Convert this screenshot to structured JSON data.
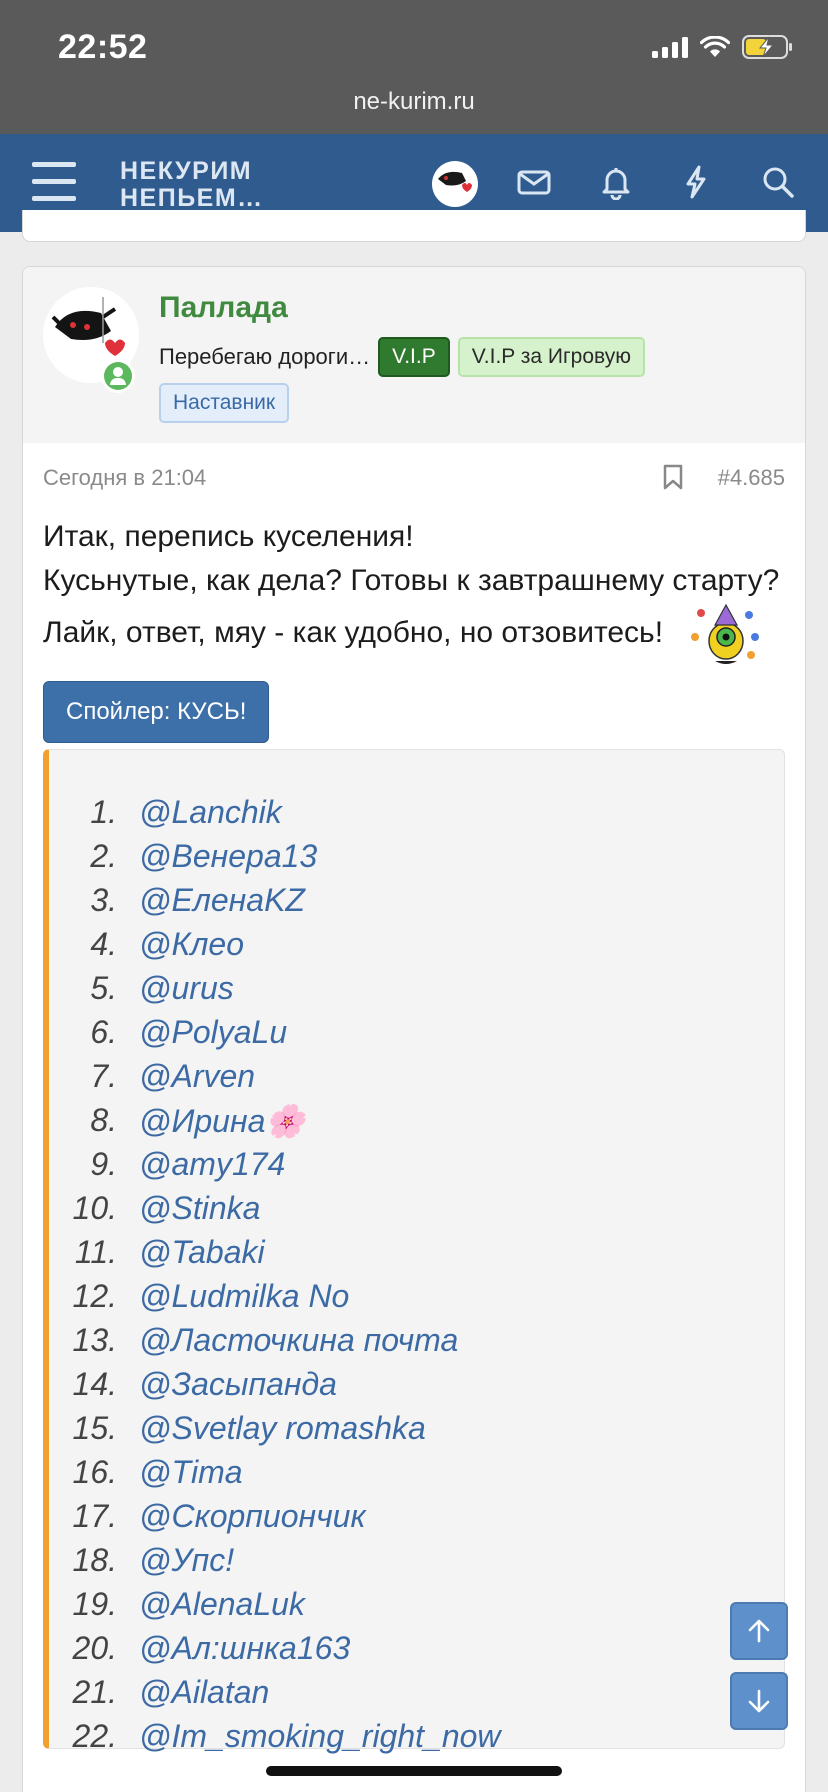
{
  "status_bar": {
    "time": "22:52",
    "url": "ne-kurim.ru"
  },
  "header": {
    "logo_line1": "НЕКУРИМ",
    "logo_line2": "НЕПЬЕМ…",
    "icons": [
      "menu-icon",
      "avatar",
      "envelope-icon",
      "bell-icon",
      "lightning-icon",
      "search-icon"
    ],
    "brand_color": "#2f5b8e"
  },
  "post": {
    "author": "Паллада",
    "user_title": "Перебегаю дороги…",
    "badges": [
      "V.I.P",
      "V.I.P за Игровую"
    ],
    "role_badge": "Наставник",
    "date": "Сегодня в 21:04",
    "number": "#4.685",
    "body_line1": "Итак, перепись куселения!",
    "body_line2": "Кусьнутые, как дела? Готовы к завтрашнему старту? Лайк, ответ, мяу - как удобно, но отзовитесь!",
    "spoiler_label": "Спойлер: КУСЬ!",
    "mentions": [
      {
        "n": "1.",
        "name": "@Lanchik"
      },
      {
        "n": "2.",
        "name": "@Венера13"
      },
      {
        "n": "3.",
        "name": "@ЕленаKZ"
      },
      {
        "n": "4.",
        "name": "@Клео"
      },
      {
        "n": "5.",
        "name": "@urus"
      },
      {
        "n": "6.",
        "name": "@PolyaLu"
      },
      {
        "n": "7.",
        "name": "@Arven"
      },
      {
        "n": "8.",
        "name": "@Ирина🌸"
      },
      {
        "n": "9.",
        "name": "@amy174"
      },
      {
        "n": "10.",
        "name": "@Stinka"
      },
      {
        "n": "11.",
        "name": "@Tabaki"
      },
      {
        "n": "12.",
        "name": "@Ludmilka No"
      },
      {
        "n": "13.",
        "name": "@Ласточкина почта"
      },
      {
        "n": "14.",
        "name": "@Засыпанда"
      },
      {
        "n": "15.",
        "name": "@Svetlay romashka"
      },
      {
        "n": "16.",
        "name": "@Тima"
      },
      {
        "n": "17.",
        "name": "@Скорпиончик"
      },
      {
        "n": "18.",
        "name": "@Упс!"
      },
      {
        "n": "19.",
        "name": "@AlenaLuk"
      },
      {
        "n": "20.",
        "name": "@Ал:шнка163"
      },
      {
        "n": "21.",
        "name": "@Ailatan"
      },
      {
        "n": "22.",
        "name": "@Im_smoking_right_now"
      }
    ]
  }
}
